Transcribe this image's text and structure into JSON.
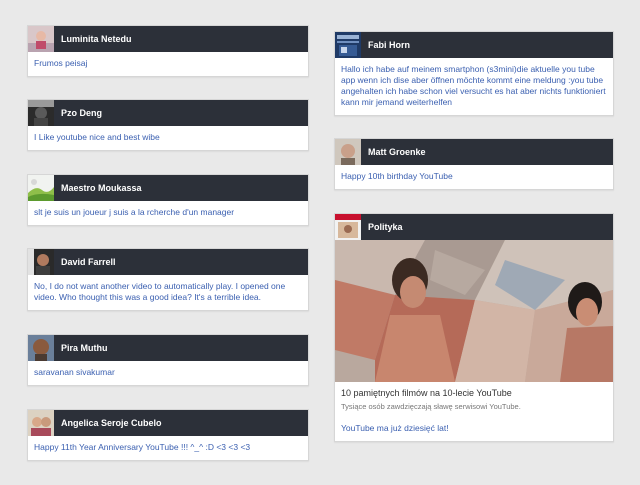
{
  "left_column": [
    {
      "author": "Luminita Netedu",
      "avatar_icon": "girl-avatar-icon",
      "comment": "Frumos peisaj"
    },
    {
      "author": "Pzo Deng",
      "avatar_icon": "dark-portrait-avatar-icon",
      "comment": "I Like youtube nice and best wibe"
    },
    {
      "author": "Maestro Moukassa",
      "avatar_icon": "landscape-avatar-icon",
      "comment": "slt je suis un joueur j suis a la rcherche d'un manager"
    },
    {
      "author": "David Farrell",
      "avatar_icon": "man-portrait-avatar-icon",
      "comment": "No, I do not want another video to automatically play. I opened one video. Who thought this was a good idea? It's a terrible idea."
    },
    {
      "author": "Pira Muthu",
      "avatar_icon": "face-avatar-icon",
      "comment": "saravanan sivakumar"
    },
    {
      "author": "Angelica Seroje Cubelo",
      "avatar_icon": "woman-avatar-icon",
      "comment": "Happy 11th Year Anniversary YouTube !!! ^_^ :D <3 <3 <3"
    }
  ],
  "right_column": {
    "fabi": {
      "author": "Fabi Horn",
      "avatar_icon": "poster-avatar-icon",
      "comment": "Hallo ich habe auf meinem smartphon (s3mini)die aktuelle you tube app wenn ich dise aber öffnen möchte kommt eine meldung :you tube angehalten ich habe schon viel versucht es hat aber nichts funktioniert kann mir jemand weiterhelfen"
    },
    "matt": {
      "author": "Matt Groenke",
      "avatar_icon": "man-avatar-icon",
      "comment": "Happy 10th birthday YouTube"
    },
    "polityka": {
      "author": "Polityka",
      "avatar_icon": "magazine-cover-avatar-icon",
      "video_title": "10 pamiętnych filmów na 10-lecie YouTube",
      "video_description": "Tysiące osób zawdzięczają sławę serwisowi YouTube.",
      "link_text": "YouTube ma już dziesięć lat!"
    }
  },
  "colors": {
    "header_bg": "#2c3039",
    "link_text": "#3a5fb0",
    "page_bg": "#e9e9e9"
  }
}
